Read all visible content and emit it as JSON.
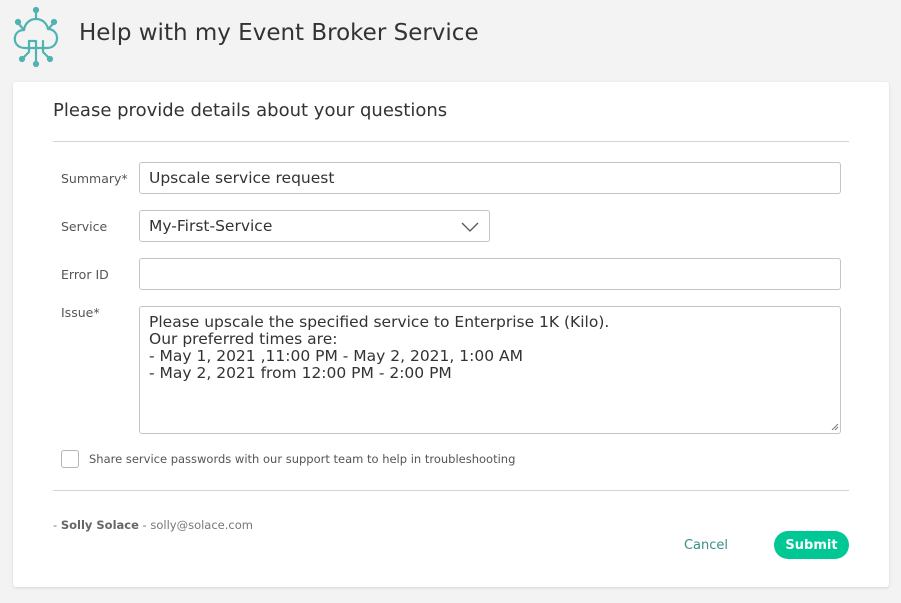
{
  "header": {
    "title": "Help with my Event Broker Service",
    "logo_icon": "cloud-network-icon",
    "logo_color": "#4fb3b1"
  },
  "form": {
    "heading": "Please provide details about your questions",
    "summary": {
      "label": "Summary*",
      "value": "Upscale service request"
    },
    "service": {
      "label": "Service",
      "value": "My-First-Service",
      "icon": "chevron-down-icon"
    },
    "error_id": {
      "label": "Error ID",
      "value": ""
    },
    "issue": {
      "label": "Issue*",
      "value": "Please upscale the specified service to Enterprise 1K (Kilo).\nOur preferred times are:\n- May 1, 2021 ,11:00 PM - May 2, 2021, 1:00 AM\n- May 2, 2021 from 12:00 PM - 2:00 PM"
    },
    "share_passwords": {
      "label": "Share service passwords with our support team to help in troubleshooting",
      "checked": false
    }
  },
  "footer": {
    "dash": "-",
    "user_name": "Solly Solace",
    "separator": "-",
    "user_email": "solly@solace.com",
    "cancel_label": "Cancel",
    "submit_label": "Submit"
  },
  "colors": {
    "accent": "#00c895",
    "link": "#3a8e87",
    "background": "#f3f3f3"
  }
}
